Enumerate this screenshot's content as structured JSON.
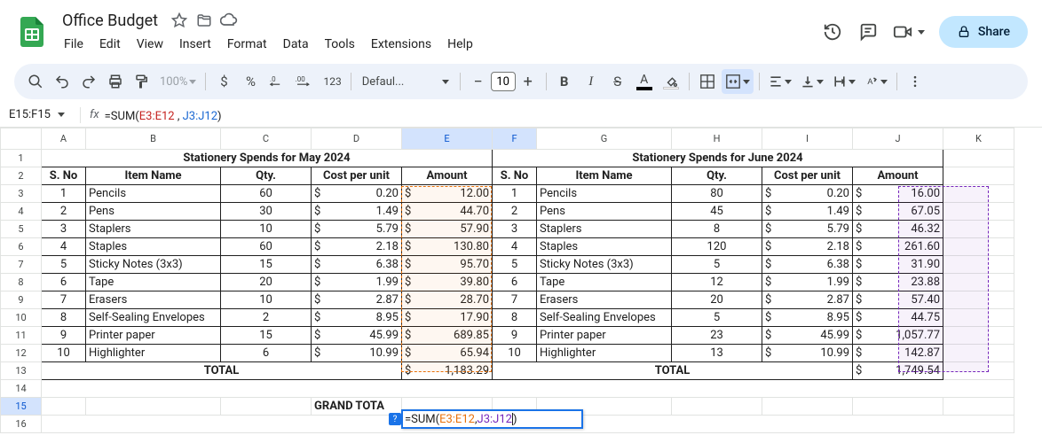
{
  "doc": {
    "title": "Office Budget"
  },
  "menu": [
    "File",
    "Edit",
    "View",
    "Insert",
    "Format",
    "Data",
    "Tools",
    "Extensions",
    "Help"
  ],
  "share": {
    "label": "Share"
  },
  "toolbar": {
    "zoom": "100%",
    "font": "Defaul...",
    "fontsize": "10"
  },
  "namebox": {
    "ref": "E15:F15"
  },
  "formula_bar": {
    "func_open": "=SUM(",
    "r1": "E3:E12",
    "sep": " , ",
    "r2": "J3:J12",
    "close": ")"
  },
  "cell_edit": {
    "func_open": "=SUM(",
    "r1": "E3:E12",
    "sep": " , ",
    "r2": "J3:J12",
    "close": ")"
  },
  "grand_total_label": "GRAND TOTA",
  "headers": {
    "may_title": "Stationery Spends for May 2024",
    "june_title": "Stationery Spends for June 2024",
    "sno": "S. No",
    "item": "Item Name",
    "qty": "Qty.",
    "cpu": "Cost per unit",
    "amount": "Amount",
    "total": "TOTAL"
  },
  "totals": {
    "may": "1,183.29",
    "june": "1,749.54"
  },
  "may": [
    {
      "n": "1",
      "item": "Pencils",
      "qty": "60",
      "cpu": "0.20",
      "amt": "12.00"
    },
    {
      "n": "2",
      "item": "Pens",
      "qty": "30",
      "cpu": "1.49",
      "amt": "44.70"
    },
    {
      "n": "3",
      "item": "Staplers",
      "qty": "10",
      "cpu": "5.79",
      "amt": "57.90"
    },
    {
      "n": "4",
      "item": "Staples",
      "qty": "60",
      "cpu": "2.18",
      "amt": "130.80"
    },
    {
      "n": "5",
      "item": "Sticky Notes (3x3)",
      "qty": "15",
      "cpu": "6.38",
      "amt": "95.70"
    },
    {
      "n": "6",
      "item": "Tape",
      "qty": "20",
      "cpu": "1.99",
      "amt": "39.80"
    },
    {
      "n": "7",
      "item": "Erasers",
      "qty": "10",
      "cpu": "2.87",
      "amt": "28.70"
    },
    {
      "n": "8",
      "item": "Self-Sealing Envelopes",
      "qty": "2",
      "cpu": "8.95",
      "amt": "17.90"
    },
    {
      "n": "9",
      "item": "Printer paper",
      "qty": "15",
      "cpu": "45.99",
      "amt": "689.85"
    },
    {
      "n": "10",
      "item": "Highlighter",
      "qty": "6",
      "cpu": "10.99",
      "amt": "65.94"
    }
  ],
  "june": [
    {
      "n": "1",
      "item": "Pencils",
      "qty": "80",
      "cpu": "0.20",
      "amt": "16.00"
    },
    {
      "n": "2",
      "item": "Pens",
      "qty": "45",
      "cpu": "1.49",
      "amt": "67.05"
    },
    {
      "n": "3",
      "item": "Staplers",
      "qty": "8",
      "cpu": "5.79",
      "amt": "46.32"
    },
    {
      "n": "4",
      "item": "Staples",
      "qty": "120",
      "cpu": "2.18",
      "amt": "261.60"
    },
    {
      "n": "5",
      "item": "Sticky Notes (3x3)",
      "qty": "5",
      "cpu": "6.38",
      "amt": "31.90"
    },
    {
      "n": "6",
      "item": "Tape",
      "qty": "12",
      "cpu": "1.99",
      "amt": "23.88"
    },
    {
      "n": "7",
      "item": "Erasers",
      "qty": "20",
      "cpu": "2.87",
      "amt": "57.40"
    },
    {
      "n": "8",
      "item": "Self-Sealing Envelopes",
      "qty": "5",
      "cpu": "8.95",
      "amt": "44.75"
    },
    {
      "n": "9",
      "item": "Printer paper",
      "qty": "23",
      "cpu": "45.99",
      "amt": "1,057.77"
    },
    {
      "n": "10",
      "item": "Highlighter",
      "qty": "13",
      "cpu": "10.99",
      "amt": "142.87"
    }
  ]
}
